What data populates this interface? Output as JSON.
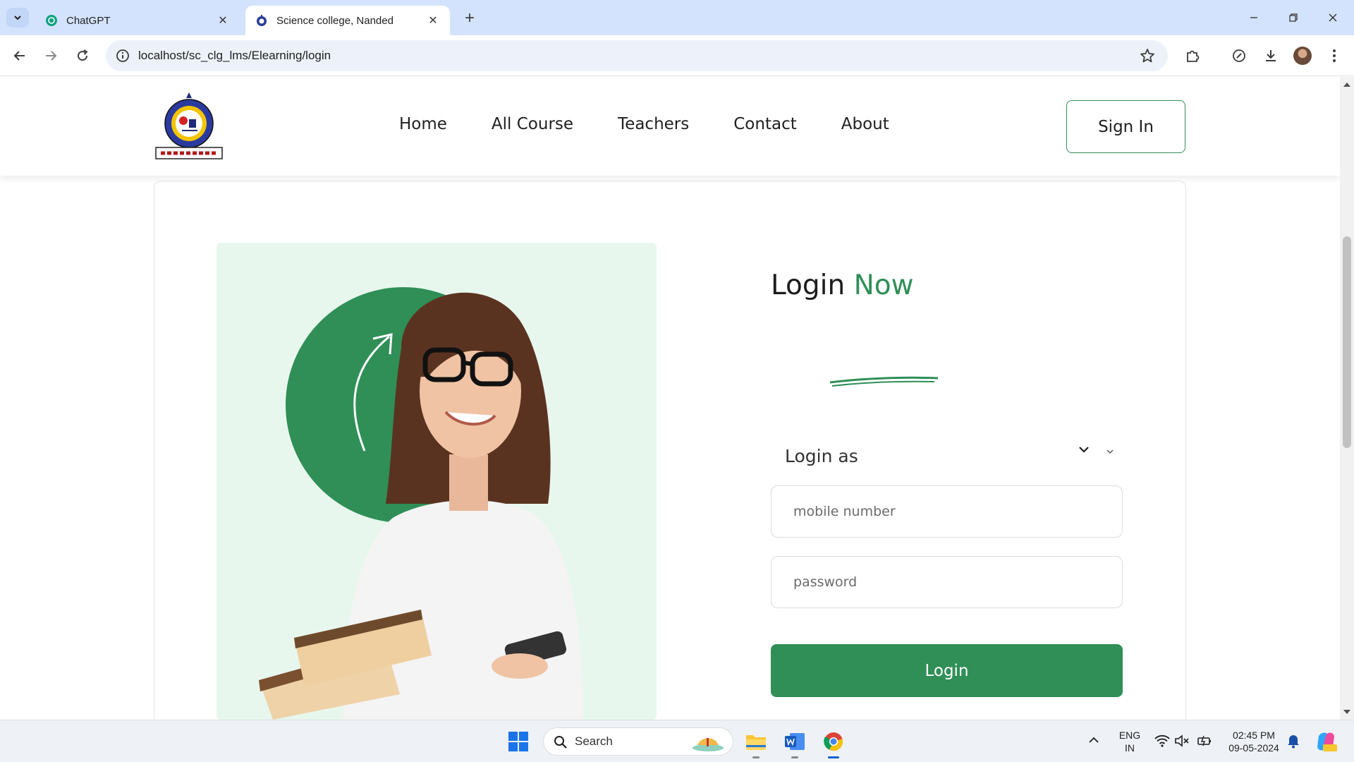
{
  "browser": {
    "tabs": [
      {
        "title": "ChatGPT",
        "active": false,
        "icon": "chatgpt-favicon"
      },
      {
        "title": "Science college, Nanded",
        "active": true,
        "icon": "college-favicon"
      }
    ],
    "url": "localhost/sc_clg_lms/Elearning/login"
  },
  "site": {
    "logo_icon": "college-seal-logo",
    "nav": [
      "Home",
      "All Course",
      "Teachers",
      "Contact",
      "About"
    ],
    "signin_label": "Sign In"
  },
  "login": {
    "title_main": "Login",
    "title_accent": "Now",
    "login_as_label": "Login as",
    "mobile_placeholder": "mobile number",
    "password_placeholder": "password",
    "button_label": "Login"
  },
  "hero": {
    "image": "student-with-books-illustration"
  },
  "colors": {
    "brand_green": "#2f8f57",
    "hero_bg": "#e8f7ee",
    "tabbar_bg": "#d3e3fd"
  },
  "taskbar": {
    "search_label": "Search",
    "lang_top": "ENG",
    "lang_bottom": "IN",
    "time": "02:45 PM",
    "date": "09-05-2024"
  }
}
